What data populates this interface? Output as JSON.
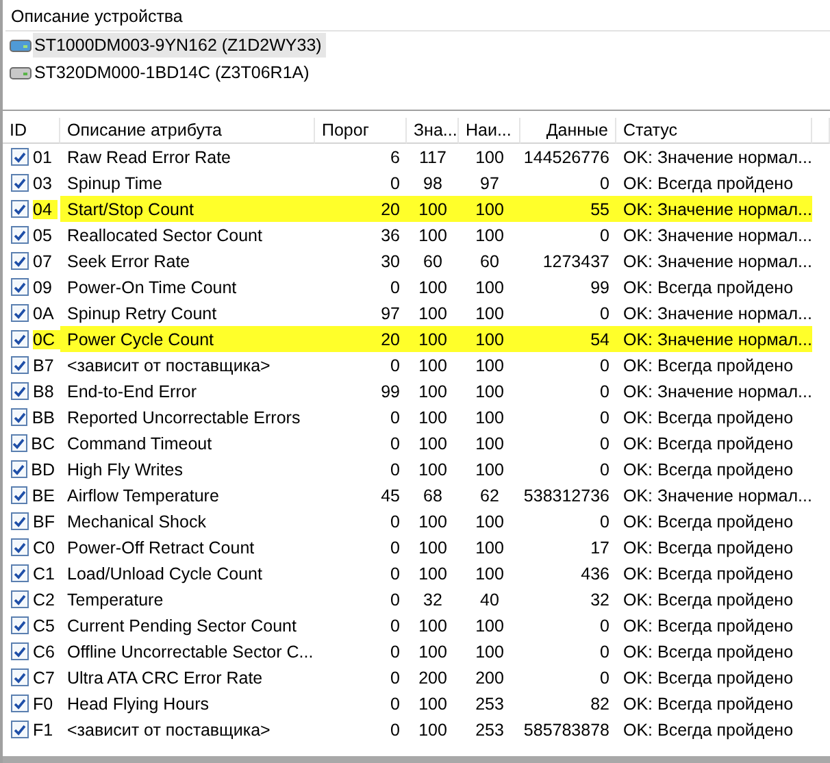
{
  "devices_panel": {
    "header": "Описание устройства",
    "devices": [
      {
        "name": "ST1000DM003-9YN162 (Z1D2WY33)",
        "selected": true,
        "kind": "primary"
      },
      {
        "name": "ST320DM000-1BD14C (Z3T06R1A)",
        "selected": false,
        "kind": "secondary"
      }
    ]
  },
  "table": {
    "columns": [
      "ID",
      "Описание атрибута",
      "Порог",
      "Зна...",
      "Наи...",
      "Данные",
      "Статус"
    ],
    "rows": [
      {
        "checked": true,
        "highlighted": false,
        "cells": [
          "01",
          "Raw Read Error Rate",
          "6",
          "117",
          "100",
          "144526776",
          "OK: Значение нормал..."
        ]
      },
      {
        "checked": true,
        "highlighted": false,
        "cells": [
          "03",
          "Spinup Time",
          "0",
          "98",
          "97",
          "0",
          "OK: Всегда пройдено"
        ]
      },
      {
        "checked": true,
        "highlighted": true,
        "cells": [
          "04",
          "Start/Stop Count",
          "20",
          "100",
          "100",
          "55",
          "OK: Значение нормал..."
        ]
      },
      {
        "checked": true,
        "highlighted": false,
        "cells": [
          "05",
          "Reallocated Sector Count",
          "36",
          "100",
          "100",
          "0",
          "OK: Значение нормал..."
        ]
      },
      {
        "checked": true,
        "highlighted": false,
        "cells": [
          "07",
          "Seek Error Rate",
          "30",
          "60",
          "60",
          "1273437",
          "OK: Значение нормал..."
        ]
      },
      {
        "checked": true,
        "highlighted": false,
        "cells": [
          "09",
          "Power-On Time Count",
          "0",
          "100",
          "100",
          "99",
          "OK: Всегда пройдено"
        ]
      },
      {
        "checked": true,
        "highlighted": false,
        "cells": [
          "0A",
          "Spinup Retry Count",
          "97",
          "100",
          "100",
          "0",
          "OK: Значение нормал..."
        ]
      },
      {
        "checked": true,
        "highlighted": true,
        "cells": [
          "0C",
          "Power Cycle Count",
          "20",
          "100",
          "100",
          "54",
          "OK: Значение нормал..."
        ]
      },
      {
        "checked": true,
        "highlighted": false,
        "cells": [
          "B7",
          "<зависит от поставщика>",
          "0",
          "100",
          "100",
          "0",
          "OK: Всегда пройдено"
        ]
      },
      {
        "checked": true,
        "highlighted": false,
        "cells": [
          "B8",
          "End-to-End Error",
          "99",
          "100",
          "100",
          "0",
          "OK: Значение нормал..."
        ]
      },
      {
        "checked": true,
        "highlighted": false,
        "cells": [
          "BB",
          "Reported Uncorrectable Errors",
          "0",
          "100",
          "100",
          "0",
          "OK: Всегда пройдено"
        ]
      },
      {
        "checked": true,
        "highlighted": false,
        "cells": [
          "BC",
          "Command Timeout",
          "0",
          "100",
          "100",
          "0",
          "OK: Всегда пройдено"
        ]
      },
      {
        "checked": true,
        "highlighted": false,
        "cells": [
          "BD",
          "High Fly Writes",
          "0",
          "100",
          "100",
          "0",
          "OK: Всегда пройдено"
        ]
      },
      {
        "checked": true,
        "highlighted": false,
        "cells": [
          "BE",
          "Airflow Temperature",
          "45",
          "68",
          "62",
          "538312736",
          "OK: Значение нормал..."
        ]
      },
      {
        "checked": true,
        "highlighted": false,
        "cells": [
          "BF",
          "Mechanical Shock",
          "0",
          "100",
          "100",
          "0",
          "OK: Всегда пройдено"
        ]
      },
      {
        "checked": true,
        "highlighted": false,
        "cells": [
          "C0",
          "Power-Off Retract Count",
          "0",
          "100",
          "100",
          "17",
          "OK: Всегда пройдено"
        ]
      },
      {
        "checked": true,
        "highlighted": false,
        "cells": [
          "C1",
          "Load/Unload Cycle Count",
          "0",
          "100",
          "100",
          "436",
          "OK: Всегда пройдено"
        ]
      },
      {
        "checked": true,
        "highlighted": false,
        "cells": [
          "C2",
          "Temperature",
          "0",
          "32",
          "40",
          "32",
          "OK: Всегда пройдено"
        ]
      },
      {
        "checked": true,
        "highlighted": false,
        "cells": [
          "C5",
          "Current Pending Sector Count",
          "0",
          "100",
          "100",
          "0",
          "OK: Всегда пройдено"
        ]
      },
      {
        "checked": true,
        "highlighted": false,
        "cells": [
          "C6",
          "Offline Uncorrectable Sector C...",
          "0",
          "100",
          "100",
          "0",
          "OK: Всегда пройдено"
        ]
      },
      {
        "checked": true,
        "highlighted": false,
        "cells": [
          "C7",
          "Ultra ATA CRC Error Rate",
          "0",
          "200",
          "200",
          "0",
          "OK: Всегда пройдено"
        ]
      },
      {
        "checked": true,
        "highlighted": false,
        "cells": [
          "F0",
          "Head Flying Hours",
          "0",
          "100",
          "253",
          "82",
          "OK: Всегда пройдено"
        ]
      },
      {
        "checked": true,
        "highlighted": false,
        "cells": [
          "F1",
          "<зависит от поставщика>",
          "0",
          "100",
          "253",
          "585783878",
          "OK: Всегда пройдено"
        ]
      }
    ]
  }
}
